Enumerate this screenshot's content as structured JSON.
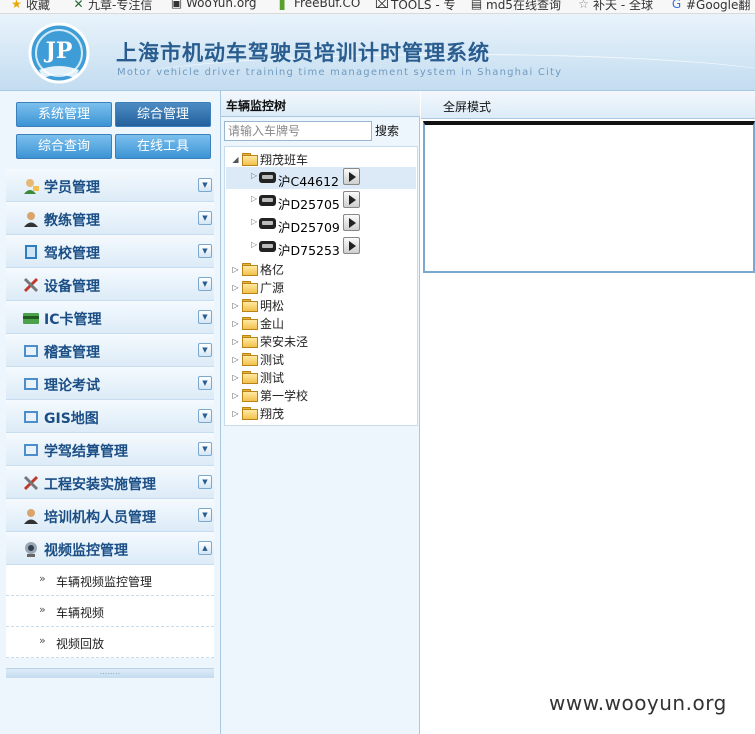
{
  "bookmarks": [
    {
      "icon": "star-icon",
      "label": "收藏"
    },
    {
      "icon": "chinese-knot-icon",
      "label": "九章-专注信"
    },
    {
      "icon": "wooyun-icon",
      "label": "WooYun.org"
    },
    {
      "icon": "freebuf-icon",
      "label": "FreeBuf.CO"
    },
    {
      "icon": "tools-icon",
      "label": "TOOLS - 专"
    },
    {
      "icon": "md5-icon",
      "label": "md5在线查询"
    },
    {
      "icon": "star-icon",
      "label": "补天 - 全球"
    },
    {
      "icon": "google-icon",
      "label": "#Google翻"
    }
  ],
  "header": {
    "title": "上海市机动车驾驶员培训计时管理系统",
    "subtitle": "Motor vehicle driver training time management system in Shanghai City",
    "logo_text": "JP"
  },
  "top_buttons": [
    "系统管理",
    "综合管理",
    "综合查询",
    "在线工具"
  ],
  "menu": [
    {
      "label": "学员管理",
      "icon": "student-icon"
    },
    {
      "label": "教练管理",
      "icon": "coach-icon"
    },
    {
      "label": "驾校管理",
      "icon": "school-icon"
    },
    {
      "label": "设备管理",
      "icon": "tools-icon"
    },
    {
      "label": "IC卡管理",
      "icon": "card-icon"
    },
    {
      "label": "稽查管理",
      "icon": "document-icon"
    },
    {
      "label": "理论考试",
      "icon": "document-icon"
    },
    {
      "label": "GIS地图",
      "icon": "document-icon"
    },
    {
      "label": "学驾结算管理",
      "icon": "document-icon"
    },
    {
      "label": "工程安装实施管理",
      "icon": "tools-icon"
    },
    {
      "label": "培训机构人员管理",
      "icon": "staff-icon"
    },
    {
      "label": "视频监控管理",
      "icon": "camera-icon"
    }
  ],
  "submenu": [
    "车辆视频监控管理",
    "车辆视频",
    "视频回放"
  ],
  "tree": {
    "title": "车辆监控树",
    "search_placeholder": "请输入车牌号",
    "search_label": "搜索",
    "root_expanded": "翔茂班车",
    "vehicles": [
      "沪C44612",
      "沪D25705",
      "沪D25709",
      "沪D75253"
    ],
    "folders": [
      "格亿",
      "广源",
      "明松",
      "金山",
      "荣安未泾",
      "测试",
      "测试",
      "第一学校",
      "翔茂"
    ]
  },
  "right": {
    "fullscreen_label": "全屏模式"
  },
  "watermark": "www.wooyun.org",
  "colors": {
    "header_title": "#2a5d8f",
    "menu_label": "#1b4e85",
    "button_blue": "#3b93d4",
    "button_active": "#23619d"
  }
}
